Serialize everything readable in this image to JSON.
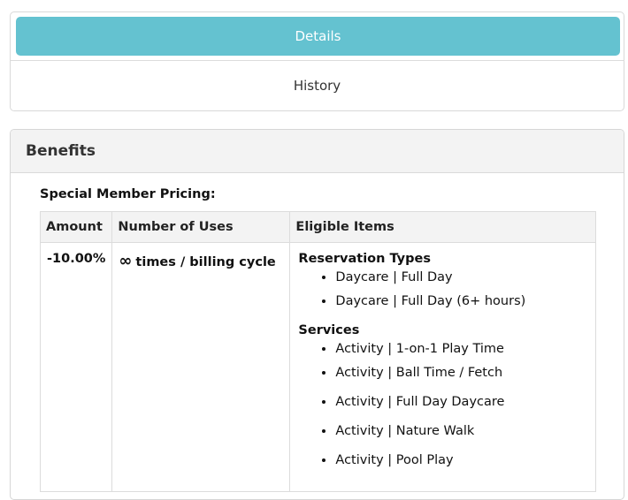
{
  "tabs": {
    "details_label": "Details",
    "history_label": "History"
  },
  "benefits": {
    "title": "Benefits",
    "section_title": "Special Member Pricing:",
    "columns": [
      "Amount",
      "Number of Uses",
      "Eligible Items"
    ],
    "row": {
      "amount": "-10.00%",
      "uses_symbol": "∞",
      "uses_text": "times / billing cycle",
      "groups": [
        {
          "title": "Reservation Types",
          "items": [
            "Daycare | Full Day",
            "Daycare | Full Day (6+ hours)"
          ]
        },
        {
          "title": "Services",
          "items": [
            "Activity | 1-on-1 Play Time",
            "Activity | Ball Time / Fetch",
            "Activity | Full Day Daycare",
            "Activity | Nature Walk",
            "Activity | Pool Play"
          ]
        }
      ]
    }
  },
  "colors": {
    "accent": "#64c2d0",
    "header_bg": "#f3f3f3",
    "border": "#d9d9d9"
  }
}
